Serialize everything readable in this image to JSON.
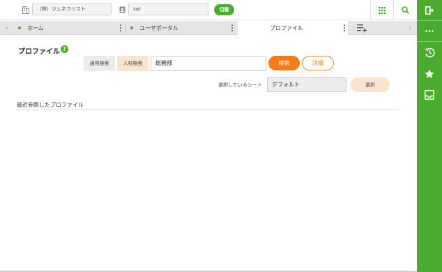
{
  "header": {
    "company": "（株）ジェネラリスト",
    "user": "sat",
    "switch_label": "切替"
  },
  "tabs": [
    {
      "label": "ホーム"
    },
    {
      "label": "ユーザポータル"
    },
    {
      "label": "プロファイル",
      "active": true
    }
  ],
  "profile": {
    "title": "プロファイル",
    "help_icon": "?",
    "normal_search_label": "通常検索",
    "talent_search_label": "人材検索",
    "search_value": "総務部",
    "search_button": "検索",
    "detail_button": "詳細",
    "selected_sheet_label": "選択しているシート",
    "selected_sheet_value": "デフォルト",
    "select_button": "選択",
    "recent_title": "最近参照したプロファイル"
  },
  "icons": {
    "company": "building-icon",
    "user": "user-icon",
    "apps": "grid-icon",
    "search": "search-icon",
    "logout": "logout-icon",
    "more": "more-icon",
    "history": "history-icon",
    "favorite": "star-icon",
    "inbox": "inbox-icon",
    "tab_add": "add-tab-icon"
  },
  "colors": {
    "brand_green": "#4aab2f",
    "accent_orange": "#f27c1c",
    "soft_orange": "#fbe4cf"
  }
}
